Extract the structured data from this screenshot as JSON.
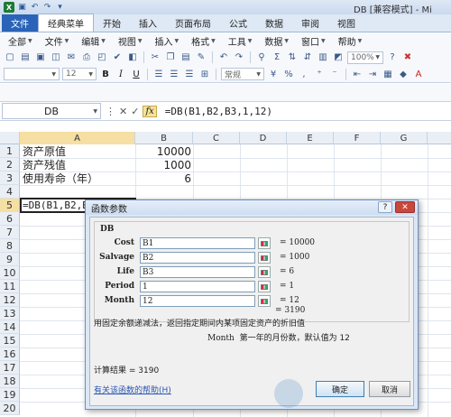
{
  "window": {
    "title": "DB  [兼容模式]  -  Mi",
    "logo": "X"
  },
  "quick_access": [
    "save-icon",
    "undo-icon",
    "redo-icon"
  ],
  "tabs": [
    {
      "label": "文件"
    },
    {
      "label": "经典菜单"
    },
    {
      "label": "开始"
    },
    {
      "label": "插入"
    },
    {
      "label": "页面布局"
    },
    {
      "label": "公式"
    },
    {
      "label": "数据"
    },
    {
      "label": "审阅"
    },
    {
      "label": "视图"
    }
  ],
  "menu": [
    {
      "label": "全部"
    },
    {
      "label": "文件"
    },
    {
      "label": "编辑"
    },
    {
      "label": "视图"
    },
    {
      "label": "插入"
    },
    {
      "label": "格式"
    },
    {
      "label": "工具"
    },
    {
      "label": "数据"
    },
    {
      "label": "窗口"
    },
    {
      "label": "帮助"
    }
  ],
  "toolbar": {
    "font_size": "12",
    "bold": "B",
    "italic": "I",
    "underline": "U",
    "number_format": "常规",
    "sigma": "Σ",
    "zoom": "100%"
  },
  "formula_bar": {
    "name_box": "DB",
    "cancel": "✕",
    "enter": "✓",
    "fx": "fx",
    "formula": "=DB(B1,B2,B3,1,12)"
  },
  "columns": [
    "A",
    "B",
    "C",
    "D",
    "E",
    "F",
    "G"
  ],
  "rows": [
    "1",
    "2",
    "3",
    "4",
    "5",
    "6",
    "7",
    "8",
    "9",
    "10",
    "11",
    "12",
    "13",
    "14",
    "15",
    "16",
    "17",
    "18",
    "19",
    "20"
  ],
  "cells": {
    "a1": "资产原值",
    "b1": "10000",
    "a2": "资产残值",
    "b2": "1000",
    "a3": "使用寿命（年）",
    "b3": "6",
    "a5": "=DB(B1,B2,B3"
  },
  "dialog": {
    "title": "函数参数",
    "help_btn": "?",
    "close_btn": "✕",
    "function_name": "DB",
    "args": [
      {
        "label": "Cost",
        "value": "B1",
        "result": "= 10000"
      },
      {
        "label": "Salvage",
        "value": "B2",
        "result": "= 1000"
      },
      {
        "label": "Life",
        "value": "B3",
        "result": "= 6"
      },
      {
        "label": "Period",
        "value": "1",
        "result": "= 1"
      },
      {
        "label": "Month",
        "value": "12",
        "result": "= 12"
      }
    ],
    "formula_result": "= 3190",
    "description": "用固定余额递减法，返回指定期间内某项固定资产的折旧值",
    "arg_help_name": "Month",
    "arg_help_text": "第一年的月份数，默认值为 12",
    "calc_result": "计算结果 =  3190",
    "help_link": "有关该函数的帮助(H)",
    "ok": "确定",
    "cancel": "取消"
  }
}
